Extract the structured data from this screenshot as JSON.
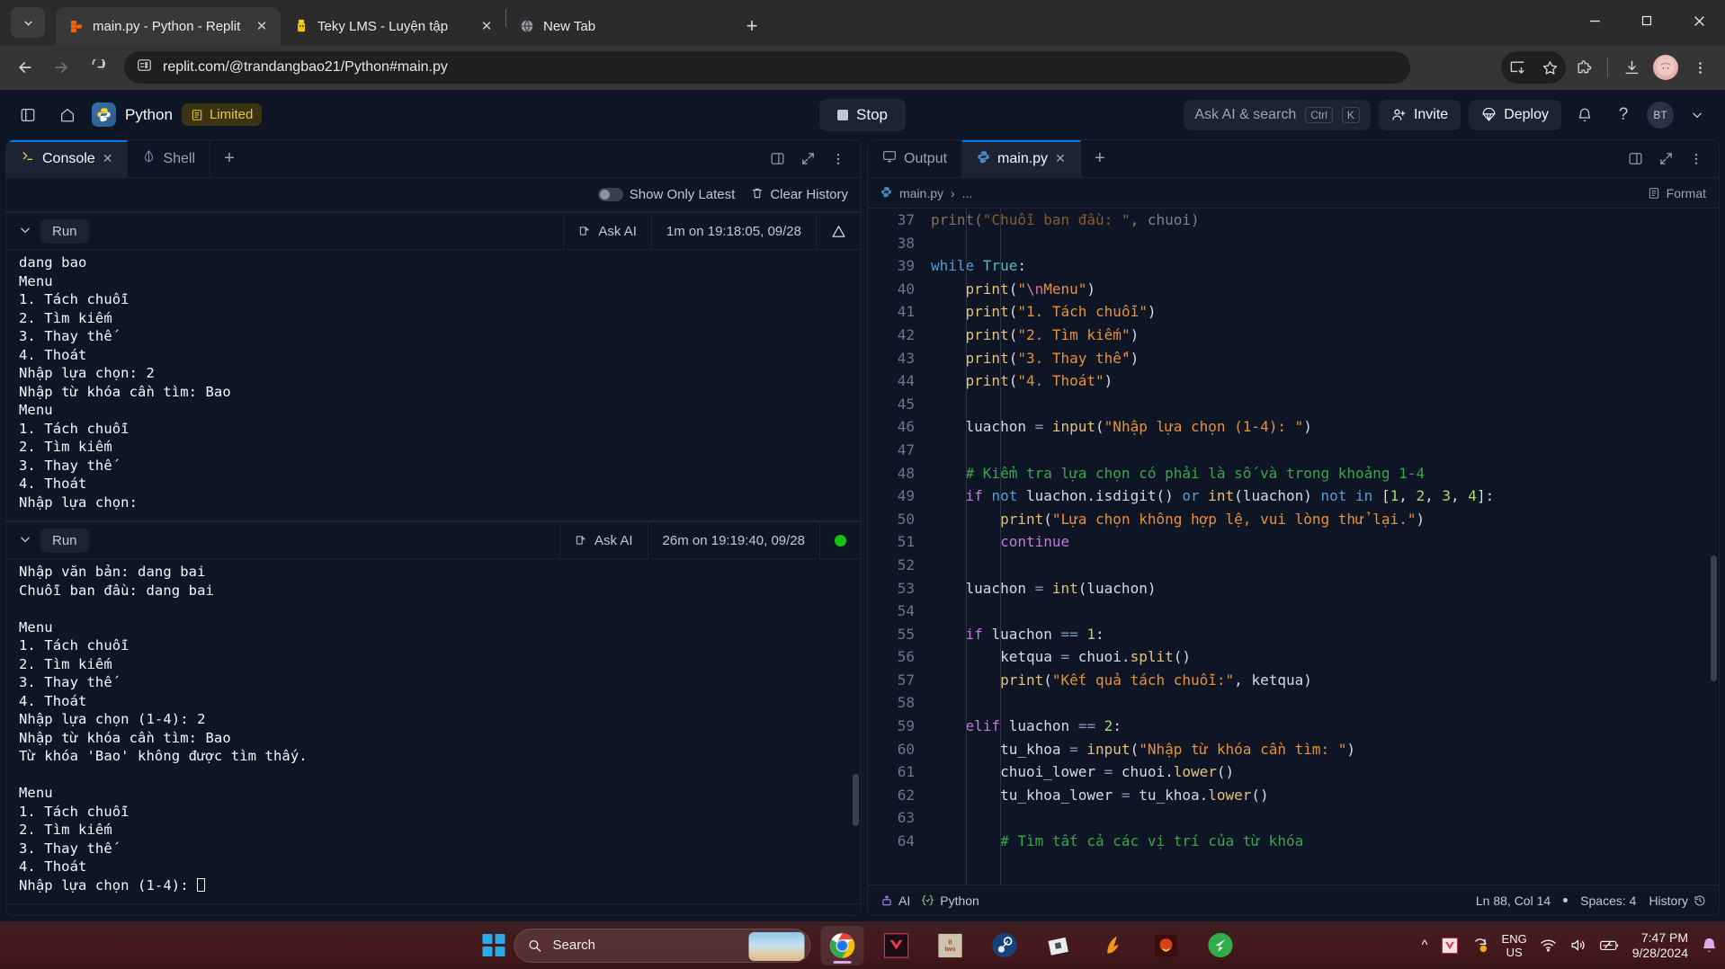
{
  "browser": {
    "tabs": [
      {
        "title": "main.py - Python - Replit",
        "favicon": "replit-icon",
        "active": true,
        "closable": true
      },
      {
        "title": "Teky LMS - Luyện tập",
        "favicon": "teky-icon",
        "active": false,
        "closable": true
      },
      {
        "title": "New Tab",
        "favicon": "globe-icon",
        "active": false,
        "closable": true
      }
    ],
    "new_tab_label": "+",
    "url": "replit.com/@trandangbao21/Python#main.py",
    "window_controls": {
      "minimize": "—",
      "maximize": "□",
      "close": "✕"
    }
  },
  "replit": {
    "project_name": "Python",
    "limited_badge": "Limited",
    "stop_button": "Stop",
    "ask_ai": {
      "label": "Ask AI & search",
      "key1": "Ctrl",
      "key2": "K"
    },
    "invite_button": "Invite",
    "deploy_button": "Deploy",
    "avatar_initials": "BT"
  },
  "console_pane": {
    "tabs": [
      {
        "label": "Console",
        "icon": "terminal-icon",
        "active": true,
        "closable": true
      },
      {
        "label": "Shell",
        "icon": "shell-icon",
        "active": false,
        "closable": false
      }
    ],
    "add_tab": "+",
    "toolbar": {
      "show_only_latest": "Show Only Latest",
      "clear_history": "Clear History"
    },
    "runs": [
      {
        "run_label": "Run",
        "ask_ai": "Ask AI",
        "timestamp": "1m on 19:18:05, 09/28",
        "status": "warning",
        "output": "dang bao\nMenu\n1. Tách chuỗi\n2. Tìm kiếm\n3. Thay thế\n4. Thoát\nNhập lựa chọn: 2\nNhập từ khóa cần tìm: Bao\nMenu\n1. Tách chuỗi\n2. Tìm kiếm\n3. Thay thế\n4. Thoát\nNhập lựa chọn:"
      },
      {
        "run_label": "Run",
        "ask_ai": "Ask AI",
        "timestamp": "26m on 19:19:40, 09/28",
        "status": "running",
        "output": "Nhập văn bản: dang bai\nChuỗi ban đầu: dang bai\n\nMenu\n1. Tách chuỗi\n2. Tìm kiếm\n3. Thay thế\n4. Thoát\nNhập lựa chọn (1-4): 2\nNhập từ khóa cần tìm: Bao\nTừ khóa 'Bao' không được tìm thấy.\n\nMenu\n1. Tách chuỗi\n2. Tìm kiếm\n3. Thay thế\n4. Thoát\nNhập lựa chọn (1-4): ",
        "output_tail": "Nhập lựa chọn (1-4): "
      }
    ]
  },
  "editor_pane": {
    "tabs": [
      {
        "label": "Output",
        "icon": "monitor-icon",
        "active": false,
        "closable": false
      },
      {
        "label": "main.py",
        "icon": "python-icon",
        "active": true,
        "closable": true
      }
    ],
    "add_tab": "+",
    "breadcrumb_file": "main.py",
    "breadcrumb_sep": "›",
    "breadcrumb_more": "...",
    "format_button": "Format",
    "status_bar": {
      "ai": "AI",
      "language": "Python",
      "cursor": "Ln 88, Col 14",
      "spaces": "Spaces: 4",
      "history": "History"
    },
    "first_line_number": 37,
    "code_lines": [
      {
        "n": 37,
        "clipped": true,
        "tokens": [
          {
            "t": "print(",
            "c": "t-fn"
          },
          {
            "t": "\"Chuỗi ban đầu: \"",
            "c": "t-str"
          },
          {
            "t": ", chuoi)",
            "c": "t-var"
          }
        ]
      },
      {
        "n": 38,
        "tokens": []
      },
      {
        "n": 39,
        "tokens": [
          {
            "t": "while ",
            "c": "t-kw"
          },
          {
            "t": "True",
            "c": "t-bool"
          },
          {
            "t": ":",
            "c": "t-var"
          }
        ]
      },
      {
        "n": 40,
        "indent": 1,
        "tokens": [
          {
            "t": "    ",
            "c": "t-var"
          },
          {
            "t": "print",
            "c": "t-fn"
          },
          {
            "t": "(",
            "c": "t-var"
          },
          {
            "t": "\"",
            "c": "t-str"
          },
          {
            "t": "\\n",
            "c": "t-esc"
          },
          {
            "t": "Menu\"",
            "c": "t-str"
          },
          {
            "t": ")",
            "c": "t-var"
          }
        ]
      },
      {
        "n": 41,
        "indent": 1,
        "tokens": [
          {
            "t": "    ",
            "c": "t-var"
          },
          {
            "t": "print",
            "c": "t-fn"
          },
          {
            "t": "(",
            "c": "t-var"
          },
          {
            "t": "\"1. Tách chuỗi\"",
            "c": "t-str"
          },
          {
            "t": ")",
            "c": "t-var"
          }
        ]
      },
      {
        "n": 42,
        "indent": 1,
        "tokens": [
          {
            "t": "    ",
            "c": "t-var"
          },
          {
            "t": "print",
            "c": "t-fn"
          },
          {
            "t": "(",
            "c": "t-var"
          },
          {
            "t": "\"2. Tìm kiếm\"",
            "c": "t-str"
          },
          {
            "t": ")",
            "c": "t-var"
          }
        ]
      },
      {
        "n": 43,
        "indent": 1,
        "tokens": [
          {
            "t": "    ",
            "c": "t-var"
          },
          {
            "t": "print",
            "c": "t-fn"
          },
          {
            "t": "(",
            "c": "t-var"
          },
          {
            "t": "\"3. Thay thế\"",
            "c": "t-str"
          },
          {
            "t": ")",
            "c": "t-var"
          }
        ]
      },
      {
        "n": 44,
        "indent": 1,
        "tokens": [
          {
            "t": "    ",
            "c": "t-var"
          },
          {
            "t": "print",
            "c": "t-fn"
          },
          {
            "t": "(",
            "c": "t-var"
          },
          {
            "t": "\"4. Thoát\"",
            "c": "t-str"
          },
          {
            "t": ")",
            "c": "t-var"
          }
        ]
      },
      {
        "n": 45,
        "indent": 1,
        "tokens": []
      },
      {
        "n": 46,
        "indent": 1,
        "tokens": [
          {
            "t": "    luachon ",
            "c": "t-var"
          },
          {
            "t": "= ",
            "c": "t-op"
          },
          {
            "t": "input",
            "c": "t-fn"
          },
          {
            "t": "(",
            "c": "t-var"
          },
          {
            "t": "\"Nhập lựa chọn (1-4): \"",
            "c": "t-str"
          },
          {
            "t": ")",
            "c": "t-var"
          }
        ]
      },
      {
        "n": 47,
        "indent": 1,
        "tokens": []
      },
      {
        "n": 48,
        "indent": 1,
        "tokens": [
          {
            "t": "    # Kiểm tra lựa chọn có phải là số và trong khoảng 1-4",
            "c": "t-cm"
          }
        ]
      },
      {
        "n": 49,
        "indent": 1,
        "tokens": [
          {
            "t": "    ",
            "c": "t-var"
          },
          {
            "t": "if ",
            "c": "t-kw2"
          },
          {
            "t": "not ",
            "c": "t-kw"
          },
          {
            "t": "luachon.isdigit() ",
            "c": "t-var"
          },
          {
            "t": "or ",
            "c": "t-kw"
          },
          {
            "t": "int",
            "c": "t-fn"
          },
          {
            "t": "(luachon) ",
            "c": "t-var"
          },
          {
            "t": "not in ",
            "c": "t-kw"
          },
          {
            "t": "[",
            "c": "t-var"
          },
          {
            "t": "1",
            "c": "t-num"
          },
          {
            "t": ", ",
            "c": "t-var"
          },
          {
            "t": "2",
            "c": "t-num"
          },
          {
            "t": ", ",
            "c": "t-var"
          },
          {
            "t": "3",
            "c": "t-num"
          },
          {
            "t": ", ",
            "c": "t-var"
          },
          {
            "t": "4",
            "c": "t-num"
          },
          {
            "t": "]:",
            "c": "t-var"
          }
        ]
      },
      {
        "n": 50,
        "indent": 2,
        "tokens": [
          {
            "t": "        ",
            "c": "t-var"
          },
          {
            "t": "print",
            "c": "t-fn"
          },
          {
            "t": "(",
            "c": "t-var"
          },
          {
            "t": "\"Lựa chọn không hợp lệ, vui lòng thử lại.\"",
            "c": "t-str"
          },
          {
            "t": ")",
            "c": "t-var"
          }
        ]
      },
      {
        "n": 51,
        "indent": 2,
        "tokens": [
          {
            "t": "        ",
            "c": "t-var"
          },
          {
            "t": "continue",
            "c": "t-kw2"
          }
        ]
      },
      {
        "n": 52,
        "indent": 1,
        "tokens": []
      },
      {
        "n": 53,
        "indent": 1,
        "tokens": [
          {
            "t": "    luachon ",
            "c": "t-var"
          },
          {
            "t": "= ",
            "c": "t-op"
          },
          {
            "t": "int",
            "c": "t-fn"
          },
          {
            "t": "(luachon)",
            "c": "t-var"
          }
        ]
      },
      {
        "n": 54,
        "indent": 1,
        "tokens": []
      },
      {
        "n": 55,
        "indent": 1,
        "tokens": [
          {
            "t": "    ",
            "c": "t-var"
          },
          {
            "t": "if ",
            "c": "t-kw2"
          },
          {
            "t": "luachon ",
            "c": "t-var"
          },
          {
            "t": "== ",
            "c": "t-op"
          },
          {
            "t": "1",
            "c": "t-num"
          },
          {
            "t": ":",
            "c": "t-var"
          }
        ]
      },
      {
        "n": 56,
        "indent": 2,
        "tokens": [
          {
            "t": "        ketqua ",
            "c": "t-var"
          },
          {
            "t": "= ",
            "c": "t-op"
          },
          {
            "t": "chuoi.",
            "c": "t-var"
          },
          {
            "t": "split",
            "c": "t-meth"
          },
          {
            "t": "()",
            "c": "t-var"
          }
        ]
      },
      {
        "n": 57,
        "indent": 2,
        "tokens": [
          {
            "t": "        ",
            "c": "t-var"
          },
          {
            "t": "print",
            "c": "t-fn"
          },
          {
            "t": "(",
            "c": "t-var"
          },
          {
            "t": "\"Kết quả tách chuỗi:\"",
            "c": "t-str"
          },
          {
            "t": ", ketqua)",
            "c": "t-var"
          }
        ]
      },
      {
        "n": 58,
        "indent": 1,
        "tokens": []
      },
      {
        "n": 59,
        "indent": 1,
        "tokens": [
          {
            "t": "    ",
            "c": "t-var"
          },
          {
            "t": "elif ",
            "c": "t-kw2"
          },
          {
            "t": "luachon ",
            "c": "t-var"
          },
          {
            "t": "== ",
            "c": "t-op"
          },
          {
            "t": "2",
            "c": "t-num"
          },
          {
            "t": ":",
            "c": "t-var"
          }
        ]
      },
      {
        "n": 60,
        "indent": 2,
        "tokens": [
          {
            "t": "        tu_khoa ",
            "c": "t-var"
          },
          {
            "t": "= ",
            "c": "t-op"
          },
          {
            "t": "input",
            "c": "t-fn"
          },
          {
            "t": "(",
            "c": "t-var"
          },
          {
            "t": "\"Nhập từ khóa cần tìm: \"",
            "c": "t-str"
          },
          {
            "t": ")",
            "c": "t-var"
          }
        ]
      },
      {
        "n": 61,
        "indent": 2,
        "tokens": [
          {
            "t": "        chuoi_lower ",
            "c": "t-var"
          },
          {
            "t": "= ",
            "c": "t-op"
          },
          {
            "t": "chuoi.",
            "c": "t-var"
          },
          {
            "t": "lower",
            "c": "t-meth"
          },
          {
            "t": "()",
            "c": "t-var"
          }
        ]
      },
      {
        "n": 62,
        "indent": 2,
        "tokens": [
          {
            "t": "        tu_khoa_lower ",
            "c": "t-var"
          },
          {
            "t": "= ",
            "c": "t-op"
          },
          {
            "t": "tu_khoa.",
            "c": "t-var"
          },
          {
            "t": "lower",
            "c": "t-meth"
          },
          {
            "t": "()",
            "c": "t-var"
          }
        ]
      },
      {
        "n": 63,
        "indent": 2,
        "tokens": []
      },
      {
        "n": 64,
        "indent": 2,
        "tokens": [
          {
            "t": "        # Tìm tất cả các vị trí của từ khóa",
            "c": "t-cm"
          }
        ]
      }
    ]
  },
  "taskbar": {
    "start": "windows-logo",
    "search_placeholder": "Search",
    "apps": [
      {
        "name": "chrome-icon",
        "active": true
      },
      {
        "name": "valorant-icon",
        "active": false
      },
      {
        "name": "it-takes-two-icon",
        "active": false
      },
      {
        "name": "steam-icon",
        "active": false
      },
      {
        "name": "roblox-icon",
        "active": false
      },
      {
        "name": "genshin-icon",
        "active": false
      },
      {
        "name": "game-icon",
        "active": false
      },
      {
        "name": "garena-icon",
        "active": false
      }
    ],
    "sys": {
      "chevron": "^",
      "language_line1": "ENG",
      "language_line2": "US",
      "time": "7:47 PM",
      "date": "9/28/2024"
    }
  }
}
